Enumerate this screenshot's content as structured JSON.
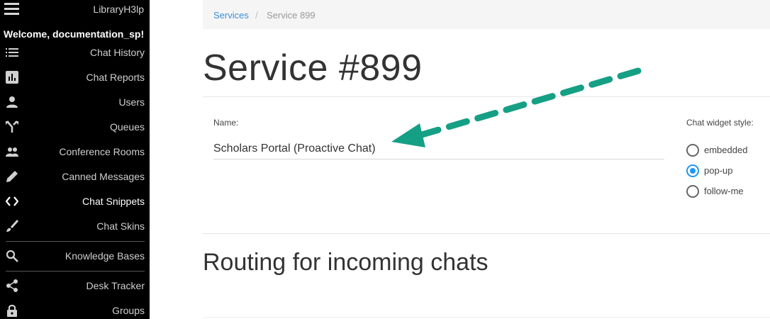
{
  "app": {
    "brand": "LibraryH3lp",
    "welcome": "Welcome, documentation_sp!"
  },
  "sidebar": {
    "items": [
      {
        "label": "Chat History",
        "icon": "list-icon"
      },
      {
        "label": "Chat Reports",
        "icon": "bar-chart-icon"
      },
      {
        "label": "Users",
        "icon": "user-icon"
      },
      {
        "label": "Queues",
        "icon": "fork-icon"
      },
      {
        "label": "Conference Rooms",
        "icon": "group-icon"
      },
      {
        "label": "Canned Messages",
        "icon": "pencil-icon"
      },
      {
        "label": "Chat Snippets",
        "icon": "code-icon",
        "active": true
      },
      {
        "label": "Chat Skins",
        "icon": "brush-icon"
      },
      {
        "label": "Knowledge Bases",
        "icon": "search-icon"
      },
      {
        "label": "Desk Tracker",
        "icon": "share-icon"
      },
      {
        "label": "Groups",
        "icon": "lock-icon"
      }
    ]
  },
  "breadcrumb": {
    "parent": "Services",
    "current": "Service 899"
  },
  "page": {
    "title": "Service #899",
    "name_label": "Name:",
    "name_value": "Scholars Portal (Proactive Chat)",
    "widget_label": "Chat widget style:",
    "widget_options": [
      "embedded",
      "pop-up",
      "follow-me"
    ],
    "widget_selected": "pop-up",
    "routing_title": "Routing for incoming chats"
  },
  "colors": {
    "accent": "#2196f3",
    "link": "#3b8fd6",
    "arrow": "#15a085",
    "sidebar_bg": "#000000"
  }
}
